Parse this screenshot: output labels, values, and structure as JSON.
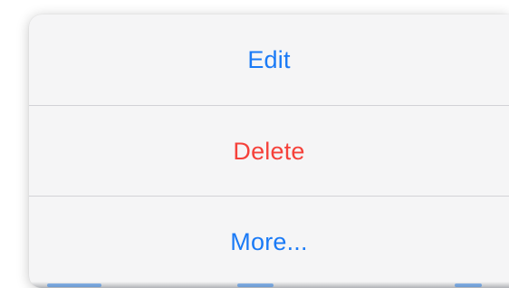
{
  "action_sheet": {
    "items": [
      {
        "label": "Edit",
        "role": "default",
        "color": "#1a7af6"
      },
      {
        "label": "Delete",
        "role": "destructive",
        "color": "#f5413a"
      },
      {
        "label": "More...",
        "role": "default",
        "color": "#1a7af6"
      }
    ]
  },
  "colors": {
    "accent": "#1a7af6",
    "destructive": "#f5413a",
    "sheet_background": "#f5f5f6",
    "divider": "#d2d2d6"
  }
}
